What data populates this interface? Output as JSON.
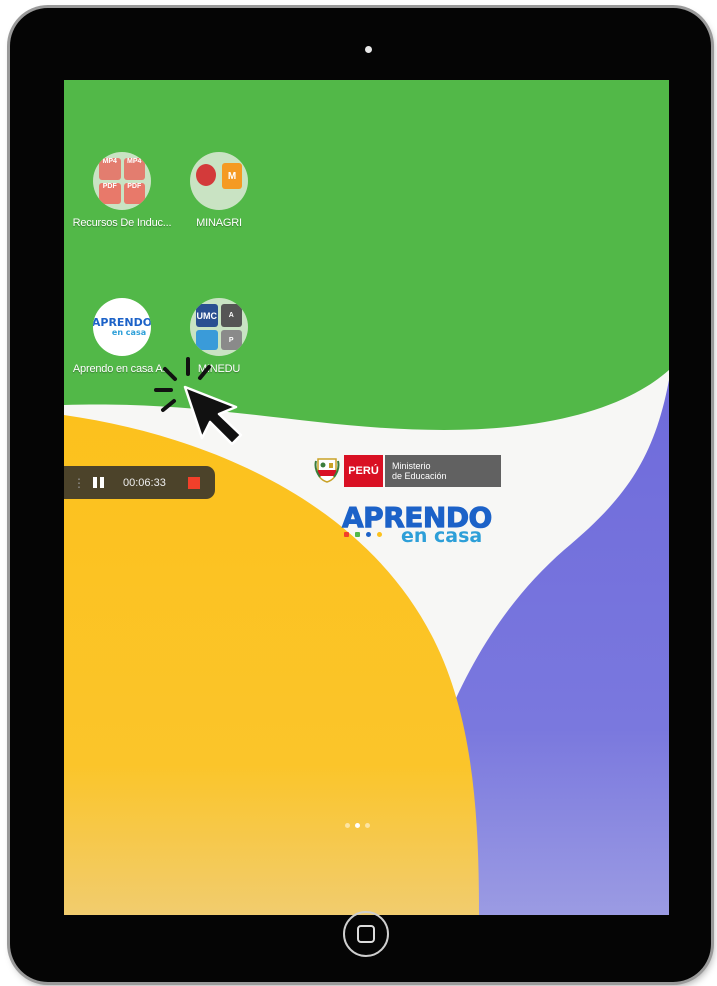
{
  "device": {
    "camera_icon": "camera-dot",
    "home_icon": "home-button"
  },
  "home_screen": {
    "apps": [
      {
        "label": "Recursos De Induc...",
        "icon": "folder-icon",
        "mini_labels": [
          "MP4",
          "MP4",
          "PDF",
          "PDF"
        ]
      },
      {
        "label": "MINAGRI",
        "icon": "folder-icon",
        "mini_labels": [
          "",
          "M"
        ]
      },
      {
        "label": "Aprendo en casa A...",
        "icon": "aprendo-app-icon",
        "icon_text": "APRENDO",
        "icon_subtext": "en casa"
      },
      {
        "label": "MINEDU",
        "icon": "folder-icon",
        "mini_labels": [
          "UMC",
          "A",
          "",
          "P"
        ]
      }
    ],
    "page_indicator": {
      "count": 3,
      "active": 1
    }
  },
  "recorder": {
    "time": "00:06:33",
    "handle_icon": "drag-handle-icon",
    "pause_icon": "pause-icon",
    "stop_icon": "stop-icon",
    "stop_color": "#f2402a"
  },
  "wallpaper": {
    "peru_label": "PERÚ",
    "ministry_line1": "Ministerio",
    "ministry_line2": "de Educación",
    "brand_title": "APRENDO",
    "brand_subtitle": "en casa",
    "colors": {
      "green": "#52b848",
      "white": "#f7f7f5",
      "purple": "#7874dc",
      "yellow": "#fcc11d",
      "brand_blue": "#1c62c8",
      "brand_light_blue": "#2d9fd8",
      "peru_red": "#d91023"
    }
  },
  "overlay": {
    "cursor_icon": "click-cursor-icon"
  }
}
